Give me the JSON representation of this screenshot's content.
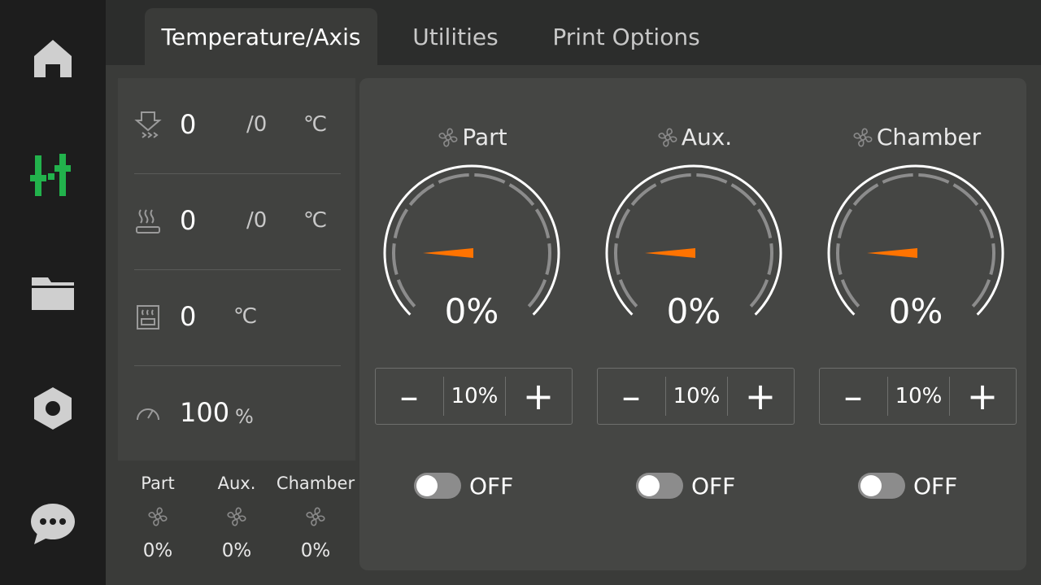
{
  "colors": {
    "accent_green": "#22b24c",
    "needle_orange": "#ff7300",
    "icon_gray": "#cfcfcf"
  },
  "sidebar": {
    "items": [
      {
        "icon": "home-icon"
      },
      {
        "icon": "sliders-icon",
        "active": true
      },
      {
        "icon": "folder-icon"
      },
      {
        "icon": "settings-nut-icon"
      },
      {
        "icon": "chat-icon"
      }
    ]
  },
  "tabs": [
    {
      "label": "Temperature/Axis",
      "active": true
    },
    {
      "label": "Utilities",
      "active": false
    },
    {
      "label": "Print Options",
      "active": false
    }
  ],
  "status": {
    "nozzle": {
      "icon": "nozzle-icon",
      "current": "0",
      "target": "/0",
      "unit": "℃"
    },
    "bed": {
      "icon": "heated-bed-icon",
      "current": "0",
      "target": "/0",
      "unit": "℃"
    },
    "chamber": {
      "icon": "chamber-icon",
      "current": "0",
      "unit": "℃"
    },
    "speed": {
      "icon": "speed-gauge-icon",
      "value": "100",
      "unit": "%"
    }
  },
  "fan_summary": [
    {
      "label": "Part",
      "value": "0%"
    },
    {
      "label": "Aux.",
      "value": "0%"
    },
    {
      "label": "Chamber",
      "value": "0%"
    }
  ],
  "fans": [
    {
      "title": "Part",
      "gauge_value": "0%",
      "gauge_fraction": 0,
      "step": "10%",
      "minus": "–",
      "plus": "+",
      "toggle": "OFF"
    },
    {
      "title": "Aux.",
      "gauge_value": "0%",
      "gauge_fraction": 0,
      "step": "10%",
      "minus": "–",
      "plus": "+",
      "toggle": "OFF"
    },
    {
      "title": "Chamber",
      "gauge_value": "0%",
      "gauge_fraction": 0,
      "step": "10%",
      "minus": "–",
      "plus": "+",
      "toggle": "OFF"
    }
  ]
}
